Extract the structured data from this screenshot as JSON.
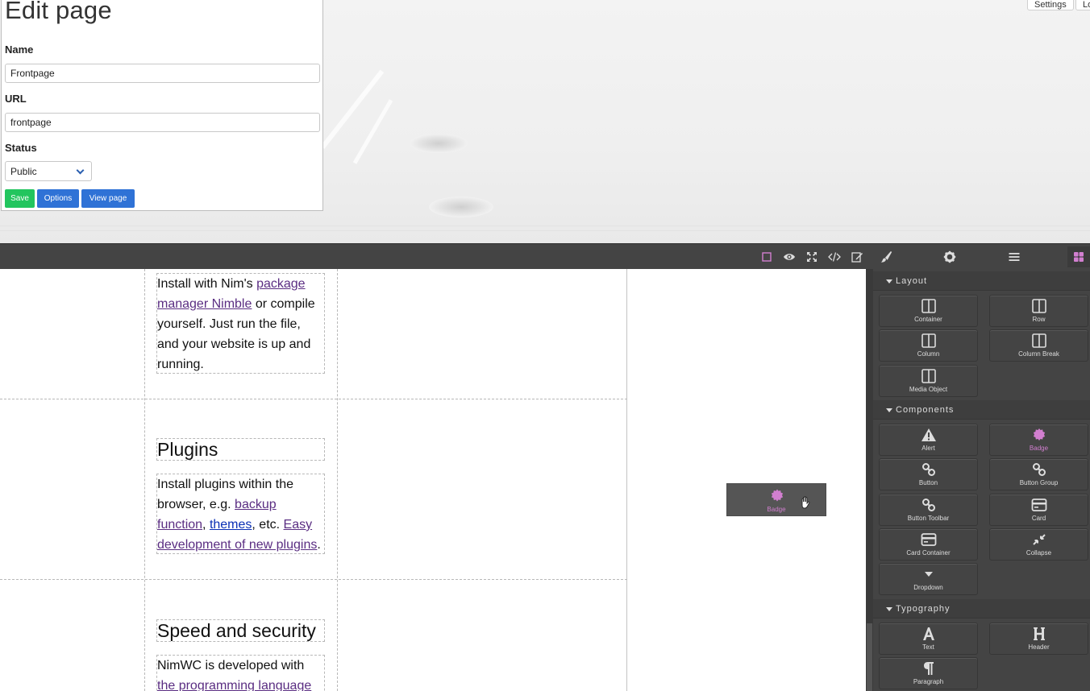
{
  "top_bar": {
    "settings_label": "Settings",
    "logout_label": "Lo"
  },
  "edit_panel": {
    "title": "Edit page",
    "name_label": "Name",
    "name_value": "Frontpage",
    "url_label": "URL",
    "url_value": "frontpage",
    "status_label": "Status",
    "status_value": "Public",
    "save_label": "Save",
    "options_label": "Options",
    "view_label": "View page",
    "colors": {
      "save": "#22c55e",
      "options": "#2f72d6",
      "view": "#2f72d6"
    }
  },
  "toolbar": {
    "icons": [
      "square-outline-icon",
      "eye-icon",
      "fullscreen-icon",
      "code-icon",
      "edit-icon",
      "brush-icon",
      "gear-icon",
      "layers-icon",
      "blocks-icon"
    ],
    "active_color": "#d27fd0"
  },
  "canvas": {
    "install_text_1": "Install with Nim's ",
    "install_link": "package manager Nimble",
    "install_text_2": " or compile yourself. Just run the file, and your website is up and running.",
    "plugins_heading": "Plugins",
    "plugins_text_1": "Install plugins within the browser, e.g. ",
    "plugins_link_1": "backup function",
    "plugins_text_2": ", ",
    "plugins_link_2": "themes",
    "plugins_text_3": ", etc. ",
    "plugins_link_3": "Easy development of new plugins",
    "plugins_text_4": ".",
    "speed_heading": "Speed and security",
    "speed_text_1": "NimWC is developed with ",
    "speed_link": "the programming language"
  },
  "drag_ghost": {
    "label": "Badge"
  },
  "blocks": {
    "layout": {
      "title": "Layout",
      "items": [
        "Container",
        "Row",
        "Column",
        "Column Break",
        "Media Object"
      ]
    },
    "components": {
      "title": "Components",
      "items": [
        "Alert",
        "Badge",
        "Button",
        "Button Group",
        "Button Toolbar",
        "Card",
        "Card Container",
        "Collapse",
        "Dropdown"
      ]
    },
    "typography": {
      "title": "Typography",
      "items": [
        "Text",
        "Header",
        "Paragraph"
      ]
    }
  }
}
